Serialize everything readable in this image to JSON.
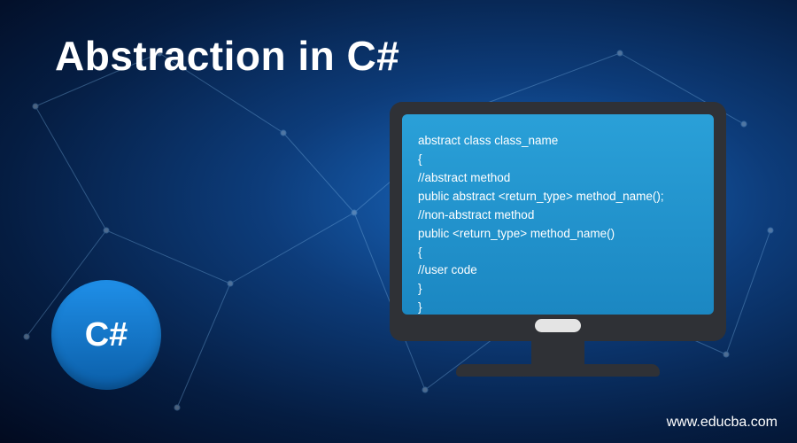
{
  "title": "Abstraction in C#",
  "badge": {
    "label": "C#"
  },
  "code_lines": [
    "abstract class class_name",
    "{",
    "//abstract method",
    "public abstract <return_type> method_name();",
    "//non-abstract method",
    "public <return_type> method_name()",
    "{",
    "//user code",
    "}",
    "}"
  ],
  "watermark": "www.educba.com",
  "colors": {
    "accent_blue": "#1f8fe8",
    "screen_blue": "#2aa0d8",
    "frame_dark": "#2f3136"
  }
}
